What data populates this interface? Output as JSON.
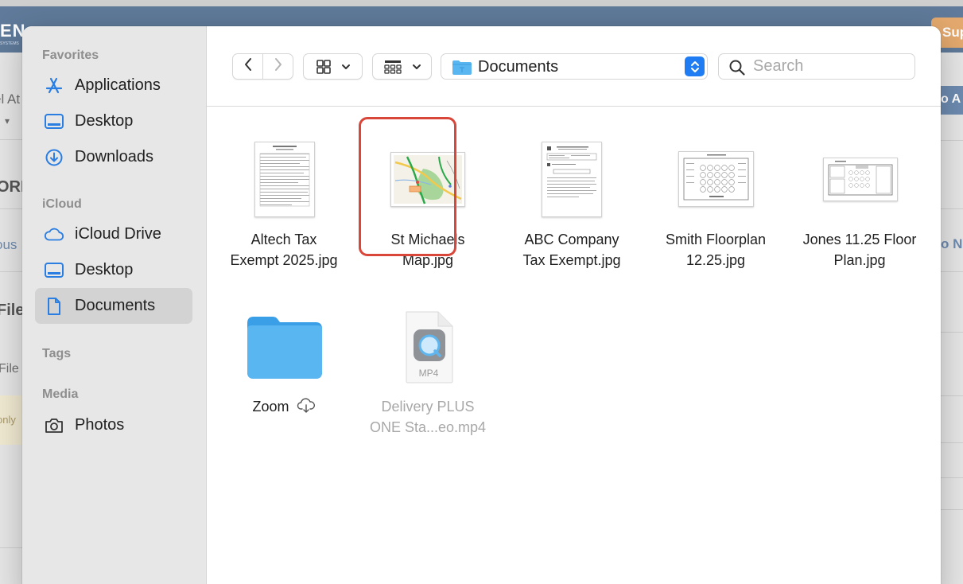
{
  "background": {
    "logo": "EN",
    "logo_sub": "SYSTEMS",
    "top_right_button": "Sup",
    "fragments": [
      "el At",
      "ORI",
      "ous",
      "File",
      "File",
      "only",
      "o A",
      "o N"
    ]
  },
  "sidebar": {
    "sections": [
      {
        "title": "Favorites",
        "items": [
          {
            "label": "Applications",
            "icon": "applications-icon"
          },
          {
            "label": "Desktop",
            "icon": "desktop-icon"
          },
          {
            "label": "Downloads",
            "icon": "downloads-icon"
          }
        ]
      },
      {
        "title": "iCloud",
        "items": [
          {
            "label": "iCloud Drive",
            "icon": "cloud-icon"
          },
          {
            "label": "Desktop",
            "icon": "desktop-icon"
          },
          {
            "label": "Documents",
            "icon": "document-icon",
            "selected": true
          }
        ]
      },
      {
        "title": "Tags",
        "items": []
      },
      {
        "title": "Media",
        "items": [
          {
            "label": "Photos",
            "icon": "camera-icon"
          }
        ]
      }
    ]
  },
  "toolbar": {
    "location": "Documents",
    "search_placeholder": "Search"
  },
  "files": [
    {
      "line1": "Altech Tax",
      "line2": "Exempt 2025.jpg",
      "kind": "document-thumbnail"
    },
    {
      "line1": "St Michaels",
      "line2": "Map.jpg",
      "kind": "map-thumbnail",
      "highlighted": true
    },
    {
      "line1": "ABC Company",
      "line2": "Tax Exempt.jpg",
      "kind": "document-thumbnail"
    },
    {
      "line1": "Smith Floorplan",
      "line2": "12.25.jpg",
      "kind": "floorplan-thumbnail"
    },
    {
      "line1": "Jones 11.25 Floor",
      "line2": "Plan.jpg",
      "kind": "floorplan-thumbnail"
    },
    {
      "line1": "Zoom",
      "line2": "",
      "kind": "folder",
      "cloud": true
    },
    {
      "line1": "Delivery PLUS",
      "line2": "ONE Sta...eo.mp4",
      "kind": "video",
      "dimmed": true,
      "badge": "MP4"
    }
  ],
  "colors": {
    "accent": "#1f7cf2",
    "highlight_border": "#d9463a",
    "folder": "#5ab6f0",
    "sidebar_bg": "#e7e7e7"
  }
}
